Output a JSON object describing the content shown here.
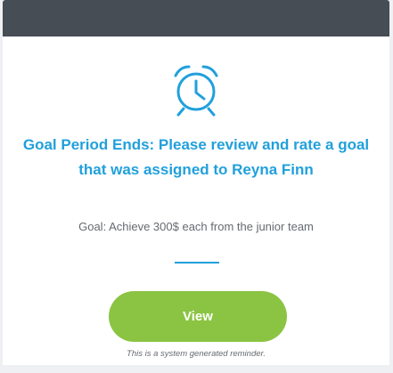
{
  "notification": {
    "title": "Goal Period Ends: Please review and rate a goal that was assigned to Reyna Finn",
    "goal_text": "Goal: Achieve 300$ each from the junior team",
    "view_label": "View",
    "footer_note": "This is a system generated reminder."
  },
  "colors": {
    "header": "#474d55",
    "accent": "#21a0dc",
    "button": "#8bc443",
    "text": "#666a70"
  },
  "icons": {
    "reminder": "alarm-clock-icon"
  }
}
